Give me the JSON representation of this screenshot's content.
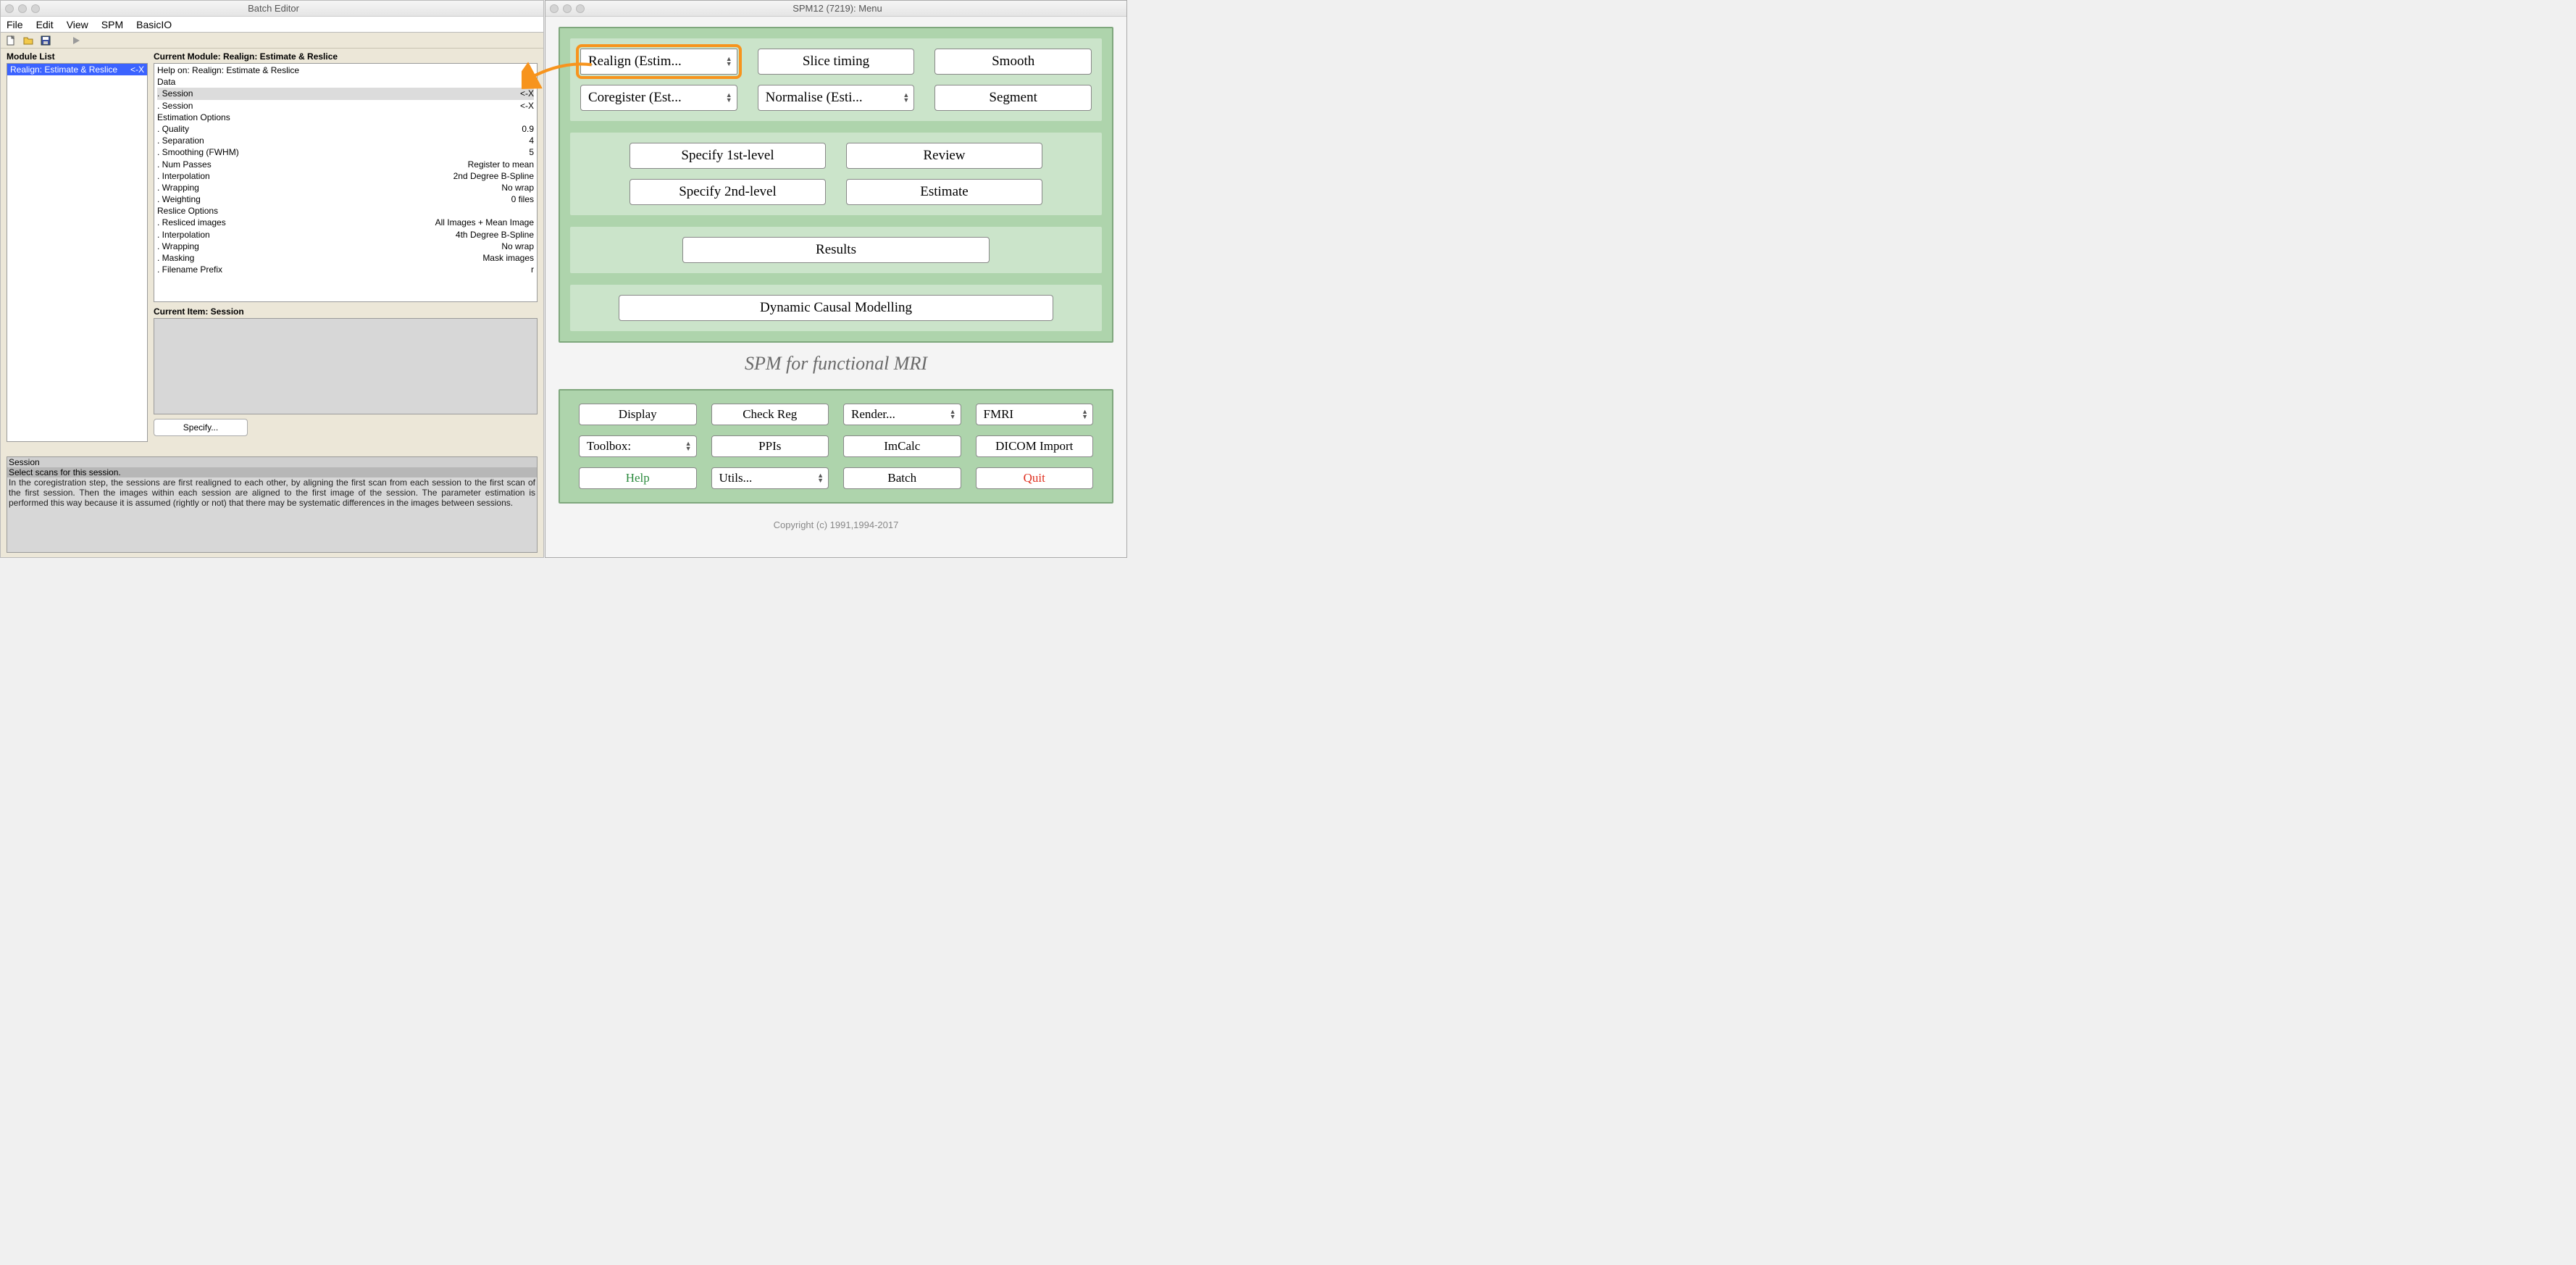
{
  "batch": {
    "title": "Batch Editor",
    "menu": [
      "File",
      "Edit",
      "View",
      "SPM",
      "BasicIO"
    ],
    "module_list_title": "Module List",
    "module_item": {
      "label": "Realign: Estimate & Reslice",
      "suffix": "<-X"
    },
    "current_module_title": "Current Module: Realign: Estimate & Reslice",
    "params": [
      {
        "k": "Help on: Realign: Estimate & Reslice",
        "v": "",
        "indent": 0
      },
      {
        "k": "Data",
        "v": "",
        "indent": 0
      },
      {
        "k": "Session",
        "v": "<-X",
        "indent": 1,
        "sel": true
      },
      {
        "k": "Session",
        "v": "<-X",
        "indent": 1
      },
      {
        "k": "Estimation Options",
        "v": "",
        "indent": 0
      },
      {
        "k": "Quality",
        "v": "0.9",
        "indent": 1
      },
      {
        "k": "Separation",
        "v": "4",
        "indent": 1
      },
      {
        "k": "Smoothing (FWHM)",
        "v": "5",
        "indent": 1
      },
      {
        "k": "Num Passes",
        "v": "Register to mean",
        "indent": 1
      },
      {
        "k": "Interpolation",
        "v": "2nd Degree B-Spline",
        "indent": 1
      },
      {
        "k": "Wrapping",
        "v": "No wrap",
        "indent": 1
      },
      {
        "k": "Weighting",
        "v": "0 files",
        "indent": 1
      },
      {
        "k": "Reslice Options",
        "v": "",
        "indent": 0
      },
      {
        "k": "Resliced images",
        "v": "All Images + Mean Image",
        "indent": 1
      },
      {
        "k": "Interpolation",
        "v": "4th Degree B-Spline",
        "indent": 1
      },
      {
        "k": "Wrapping",
        "v": "No wrap",
        "indent": 1
      },
      {
        "k": "Masking",
        "v": "Mask images",
        "indent": 1
      },
      {
        "k": "Filename Prefix",
        "v": "r",
        "indent": 1
      }
    ],
    "current_item_label": "Current Item: Session",
    "specify_label": "Specify...",
    "help": {
      "l1": "Session",
      "l2": "Select scans for this session.",
      "body": "In the coregistration step, the sessions are first realigned to each other, by aligning the first scan from each session to the first scan of the first session.  Then the images within each session are aligned to the first image of the session. The parameter estimation is performed this way because it is assumed (rightly or not) that there may be systematic differences in the images between sessions."
    }
  },
  "spm": {
    "title": "SPM12 (7219): Menu",
    "preproc": {
      "realign": "Realign (Estim...",
      "slice": "Slice timing",
      "smooth": "Smooth",
      "coreg": "Coregister (Est...",
      "norm": "Normalise (Esti...",
      "segment": "Segment"
    },
    "model": {
      "spec1": "Specify 1st-level",
      "review": "Review",
      "spec2": "Specify 2nd-level",
      "estimate": "Estimate",
      "results": "Results",
      "dcm": "Dynamic Causal Modelling"
    },
    "subtitle": "SPM for functional MRI",
    "util": {
      "display": "Display",
      "checkreg": "Check Reg",
      "render": "Render...",
      "fmri": "FMRI",
      "toolbox": "Toolbox:",
      "ppis": "PPIs",
      "imcalc": "ImCalc",
      "dicom": "DICOM Import",
      "help": "Help",
      "utils": "Utils...",
      "batch": "Batch",
      "quit": "Quit"
    },
    "copyright": "Copyright (c) 1991,1994-2017"
  }
}
